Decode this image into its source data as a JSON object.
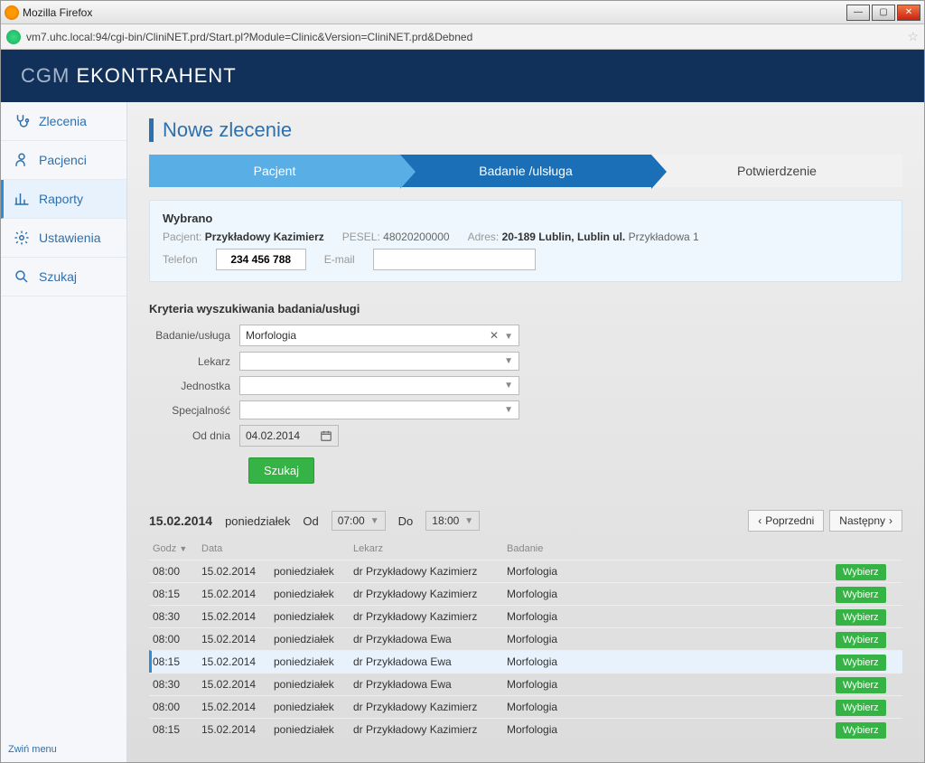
{
  "browser": {
    "title": "Mozilla Firefox",
    "url": "vm7.uhc.local:94/cgi-bin/CliniNET.prd/Start.pl?Module=Clinic&Version=CliniNET.prd&Debned"
  },
  "brand": {
    "prefix": "CGM",
    "name": "EKONTRAHENT"
  },
  "sidebar": {
    "items": [
      {
        "label": "Zlecenia"
      },
      {
        "label": "Pacjenci"
      },
      {
        "label": "Raporty"
      },
      {
        "label": "Ustawienia"
      },
      {
        "label": "Szukaj"
      }
    ],
    "collapse": "Zwiń menu"
  },
  "page": {
    "title": "Nowe zlecenie"
  },
  "stepper": {
    "s1": "Pacjent",
    "s2": "Badanie /ulsługa",
    "s3": "Potwierdzenie"
  },
  "selected": {
    "title": "Wybrano",
    "patient_lbl": "Pacjent:",
    "patient": "Przykładowy Kazimierz",
    "pesel_lbl": "PESEL:",
    "pesel": "48020200000",
    "addr_lbl": "Adres:",
    "addr_bold": "20-189 Lublin, Lublin ul.",
    "addr_rest": "Przykładowa 1",
    "tel_lbl": "Telefon",
    "tel": "234 456 788",
    "email_lbl": "E-mail",
    "email": ""
  },
  "criteria": {
    "title": "Kryteria wyszukiwania badania/usługi",
    "service_lbl": "Badanie/usługa",
    "service_val": "Morfologia",
    "doctor_lbl": "Lekarz",
    "unit_lbl": "Jednostka",
    "spec_lbl": "Specjalność",
    "from_lbl": "Od dnia",
    "from_val": "04.02.2014",
    "search_btn": "Szukaj"
  },
  "results": {
    "date": "15.02.2014",
    "day": "poniedziałek",
    "from_lbl": "Od",
    "from_val": "07:00",
    "to_lbl": "Do",
    "to_val": "18:00",
    "prev": "Poprzedni",
    "next": "Następny",
    "cols": {
      "time": "Godz",
      "date": "Data",
      "doc": "Lekarz",
      "study": "Badanie"
    },
    "choose": "Wybierz",
    "rows": [
      {
        "t": "08:00",
        "d": "15.02.2014",
        "day": "poniedziałek",
        "doc": "dr Przykładowy Kazimierz",
        "study": "Morfologia"
      },
      {
        "t": "08:15",
        "d": "15.02.2014",
        "day": "poniedziałek",
        "doc": "dr Przykładowy Kazimierz",
        "study": "Morfologia"
      },
      {
        "t": "08:30",
        "d": "15.02.2014",
        "day": "poniedziałek",
        "doc": "dr Przykładowy Kazimierz",
        "study": "Morfologia"
      },
      {
        "t": "08:00",
        "d": "15.02.2014",
        "day": "poniedziałek",
        "doc": "dr Przykładowa Ewa",
        "study": "Morfologia"
      },
      {
        "t": "08:15",
        "d": "15.02.2014",
        "day": "poniedziałek",
        "doc": "dr Przykładowa Ewa",
        "study": "Morfologia",
        "sel": true
      },
      {
        "t": "08:30",
        "d": "15.02.2014",
        "day": "poniedziałek",
        "doc": "dr Przykładowa Ewa",
        "study": "Morfologia"
      },
      {
        "t": "08:00",
        "d": "15.02.2014",
        "day": "poniedziałek",
        "doc": "dr Przykładowy Kazimierz",
        "study": "Morfologia"
      },
      {
        "t": "08:15",
        "d": "15.02.2014",
        "day": "poniedziałek",
        "doc": "dr Przykładowy Kazimierz",
        "study": "Morfologia"
      }
    ]
  }
}
